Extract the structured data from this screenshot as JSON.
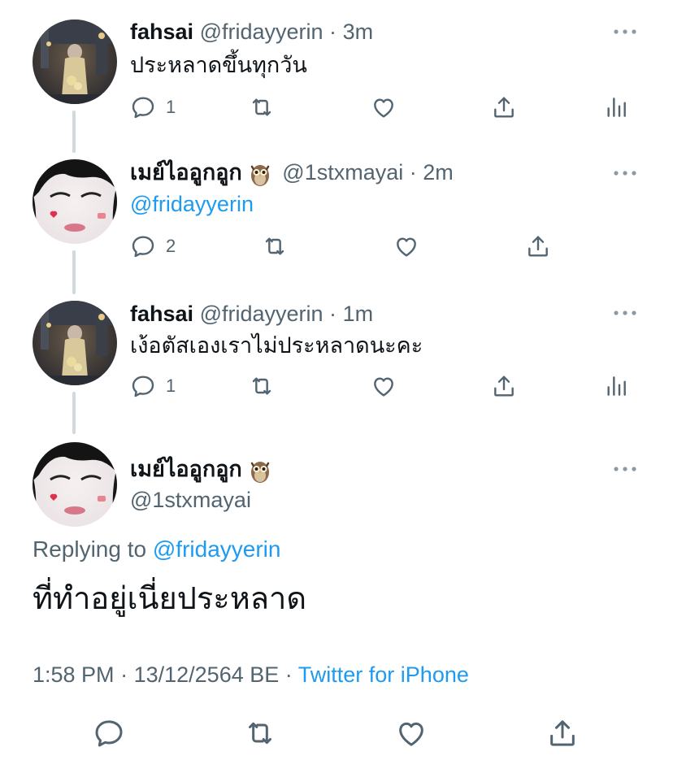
{
  "tweets": [
    {
      "name": "fahsai",
      "handle": "@fridayyerin",
      "sep": "·",
      "time": "3m",
      "text": "ประหลาดขึ้นทุกวัน",
      "reply_count": "1",
      "avatar": "street-photo"
    },
    {
      "name": "เมย์ไออูกอูก",
      "emoji": "owl",
      "handle": "@1stxmayai",
      "sep": "·",
      "time": "2m",
      "text": "@fridayyerin",
      "text_is_mention": true,
      "reply_count": "2",
      "avatar": "face-photo"
    },
    {
      "name": "fahsai",
      "handle": "@fridayyerin",
      "sep": "·",
      "time": "1m",
      "text": "เง้อตัสเองเราไม่ประหลาดนะคะ",
      "reply_count": "1",
      "avatar": "street-photo"
    }
  ],
  "main": {
    "name": "เมย์ไออูกอูก",
    "emoji": "owl",
    "handle": "@1stxmayai",
    "replying_label": "Replying to",
    "replying_to": "@fridayyerin",
    "text": "ที่ทำอยู่เนี่ยประหลาด",
    "time": "1:58 PM",
    "sep": "·",
    "date": "13/12/2564 BE",
    "source": "Twitter for iPhone"
  },
  "colors": {
    "text": "#0f1419",
    "secondary": "#536471",
    "link": "#1d9bf0",
    "thread": "#cfd9de"
  },
  "icons": [
    "reply-icon",
    "retweet-icon",
    "like-icon",
    "share-icon",
    "analytics-icon",
    "more-icon",
    "owl-emoji-icon"
  ]
}
